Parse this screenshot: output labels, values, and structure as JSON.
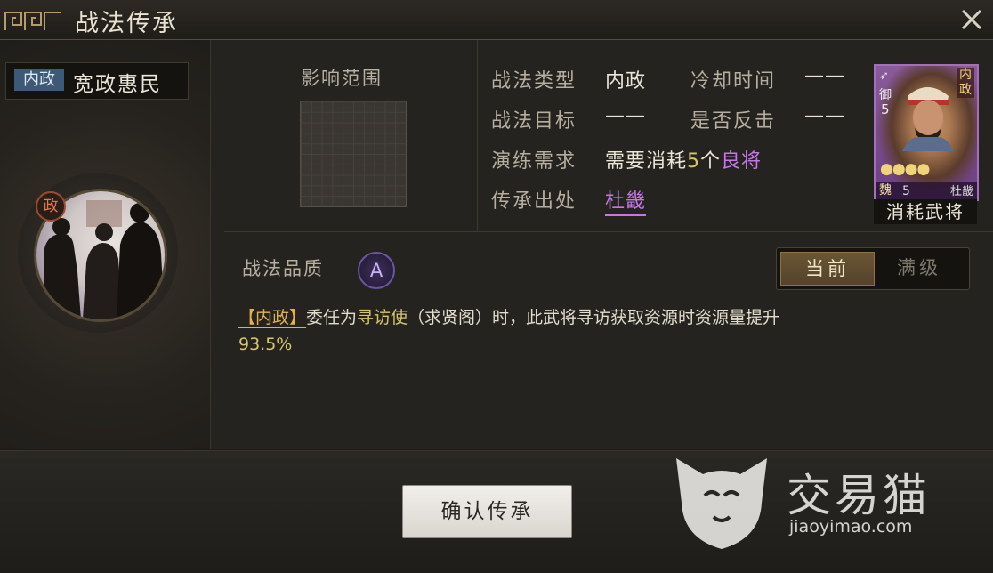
{
  "window": {
    "title": "战法传承",
    "close_icon": "close-icon"
  },
  "skill": {
    "type_tag": "内政",
    "name": "宽政惠民",
    "portrait_badge": "政"
  },
  "range": {
    "label": "影响范围"
  },
  "info": {
    "type_label": "战法类型",
    "type_value": "内政",
    "cooldown_label": "冷却时间",
    "cooldown_value": "——",
    "target_label": "战法目标",
    "target_value": "——",
    "counter_label": "是否反击",
    "counter_value": "——",
    "requirement_label": "演练需求",
    "requirement_prefix": "需要消耗",
    "requirement_count": "5",
    "requirement_unit": "个",
    "requirement_quality": "良将",
    "source_label": "传承出处",
    "source_value": "杜畿"
  },
  "card": {
    "type": "内政",
    "troop": "御",
    "level": "5",
    "stars": "●●●●",
    "faction": "魏",
    "cost": "5",
    "name": "杜畿",
    "consume_label": "消耗武将"
  },
  "quality": {
    "label": "战法品质",
    "grade": "A"
  },
  "toggle": {
    "current": "当前",
    "max": "满级"
  },
  "description": {
    "tag": "【内政】",
    "before": "委任为",
    "highlight": "寻访使",
    "after": "（求贤阁）时，此武将寻访获取资源时资源量提升",
    "value": "93.5%"
  },
  "confirm_button": "确认传承",
  "watermark": {
    "name": "交易猫",
    "url": "jiaoyimao.com"
  },
  "colors": {
    "accent_gold": "#d7c56a",
    "accent_purple": "#c677e6",
    "tag_blue": "#3e5976"
  }
}
